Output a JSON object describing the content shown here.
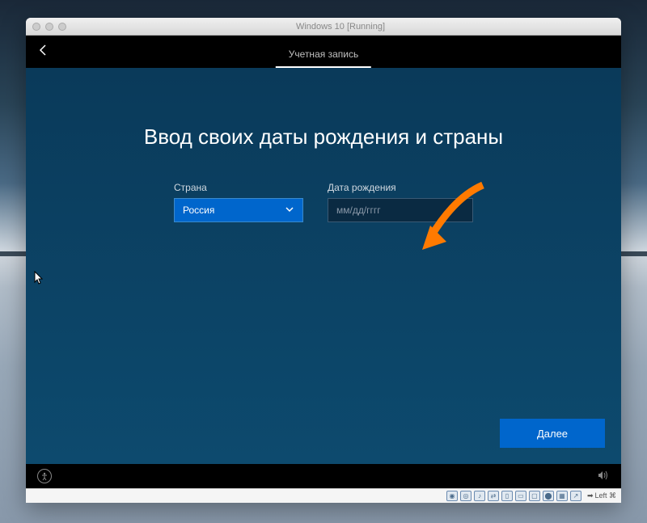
{
  "window": {
    "title": "Windows 10 [Running]"
  },
  "setup": {
    "tab_label": "Учетная запись",
    "heading": "Ввод своих даты рождения и страны",
    "country_label": "Страна",
    "country_value": "Россия",
    "dob_label": "Дата рождения",
    "dob_placeholder": "мм/дд/гггг",
    "next_button": "Далее"
  },
  "statusbar": {
    "host_key": "Left ⌘"
  }
}
